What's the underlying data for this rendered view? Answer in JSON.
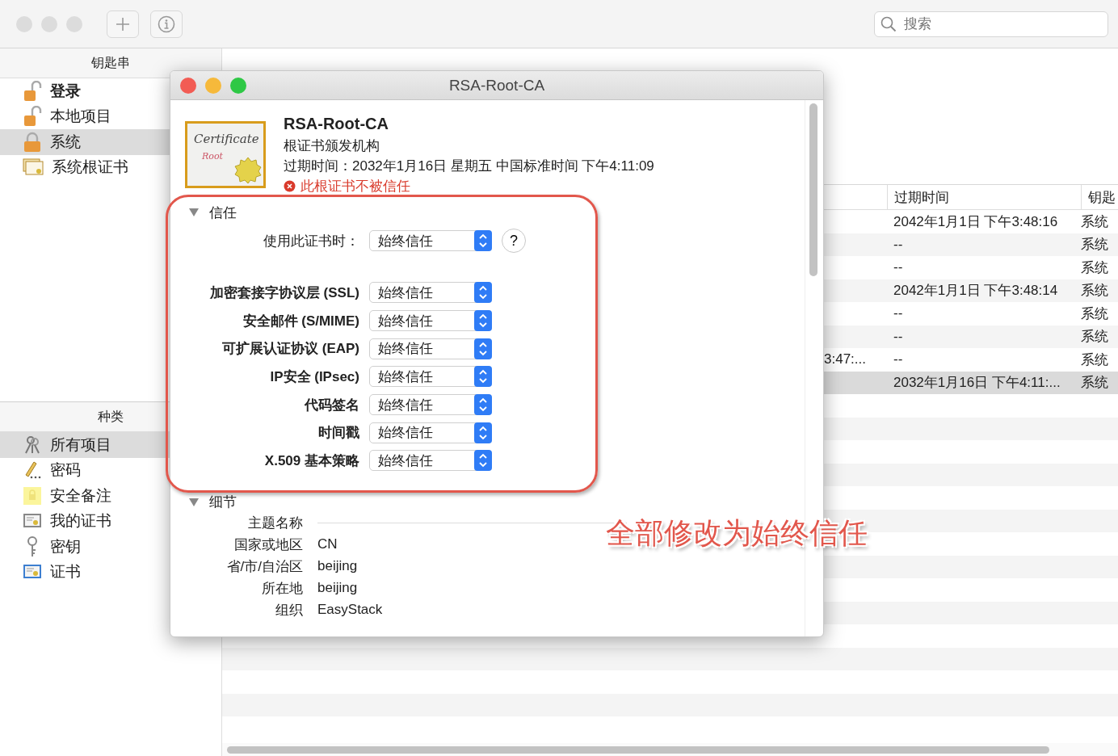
{
  "toolbar": {
    "search": {
      "placeholder": "搜索"
    }
  },
  "sidebar": {
    "keychains_header": "钥匙串",
    "keychains": [
      {
        "label": "登录",
        "kind": "unlocked",
        "selected": false,
        "bold": true
      },
      {
        "label": "本地项目",
        "kind": "unlocked",
        "selected": false,
        "bold": false
      },
      {
        "label": "系统",
        "kind": "locked",
        "selected": true,
        "bold": false
      },
      {
        "label": "系统根证书",
        "kind": "certs",
        "selected": false,
        "bold": false
      }
    ],
    "categories_header": "种类",
    "categories": [
      {
        "label": "所有项目",
        "kind": "keys",
        "selected": true
      },
      {
        "label": "密码",
        "kind": "pencil",
        "selected": false
      },
      {
        "label": "安全备注",
        "kind": "note",
        "selected": false
      },
      {
        "label": "我的证书",
        "kind": "mycert",
        "selected": false
      },
      {
        "label": "密钥",
        "kind": "key",
        "selected": false
      },
      {
        "label": "证书",
        "kind": "cert",
        "selected": false
      }
    ]
  },
  "table": {
    "columns": [
      "过期时间",
      "钥匙"
    ],
    "rows": [
      {
        "expires": "2042年1月1日 下午3:48:16",
        "keychain": "系统",
        "selected": false
      },
      {
        "expires": "--",
        "keychain": "系统",
        "selected": false
      },
      {
        "expires": "--",
        "keychain": "系统",
        "selected": false
      },
      {
        "expires": "2042年1月1日 下午3:48:14",
        "keychain": "系统",
        "selected": false
      },
      {
        "expires": "--",
        "keychain": "系统",
        "selected": false
      },
      {
        "expires": "--",
        "keychain": "系统",
        "selected": false
      },
      {
        "column_1": "3:47:...",
        "expires": "--",
        "keychain": "系统",
        "selected": false
      },
      {
        "expires": "2032年1月16日 下午4:11:...",
        "keychain": "系统",
        "selected": true
      }
    ]
  },
  "dialog": {
    "title": "RSA-Root-CA",
    "certificate": {
      "icon_text": [
        "Certificate",
        "Root"
      ],
      "name": "RSA-Root-CA",
      "subtitle": "根证书颁发机构",
      "expiry": "过期时间：2032年1月16日 星期五 中国标准时间 下午4:11:09",
      "warning": "此根证书不被信任"
    },
    "trust": {
      "title": "信任",
      "expanded": true,
      "when_using": {
        "label": "使用此证书时：",
        "value": "始终信任",
        "help": "?"
      },
      "rows": [
        {
          "label": "加密套接字协议层 (SSL)",
          "value": "始终信任"
        },
        {
          "label": "安全邮件 (S/MIME)",
          "value": "始终信任"
        },
        {
          "label": "可扩展认证协议 (EAP)",
          "value": "始终信任"
        },
        {
          "label": "IP安全 (IPsec)",
          "value": "始终信任"
        },
        {
          "label": "代码签名",
          "value": "始终信任"
        },
        {
          "label": "时间戳",
          "value": "始终信任"
        },
        {
          "label": "X.509 基本策略",
          "value": "始终信任"
        }
      ]
    },
    "details": {
      "title": "细节",
      "expanded": true,
      "rows": [
        {
          "label": "主题名称",
          "value": ""
        },
        {
          "label": "国家或地区",
          "value": "CN"
        },
        {
          "label": "省/市/自治区",
          "value": "beijing"
        },
        {
          "label": "所在地",
          "value": "beijing"
        },
        {
          "label": "组织",
          "value": "EasyStack"
        }
      ]
    }
  },
  "annotation": {
    "text": "全部修改为始终信任"
  }
}
